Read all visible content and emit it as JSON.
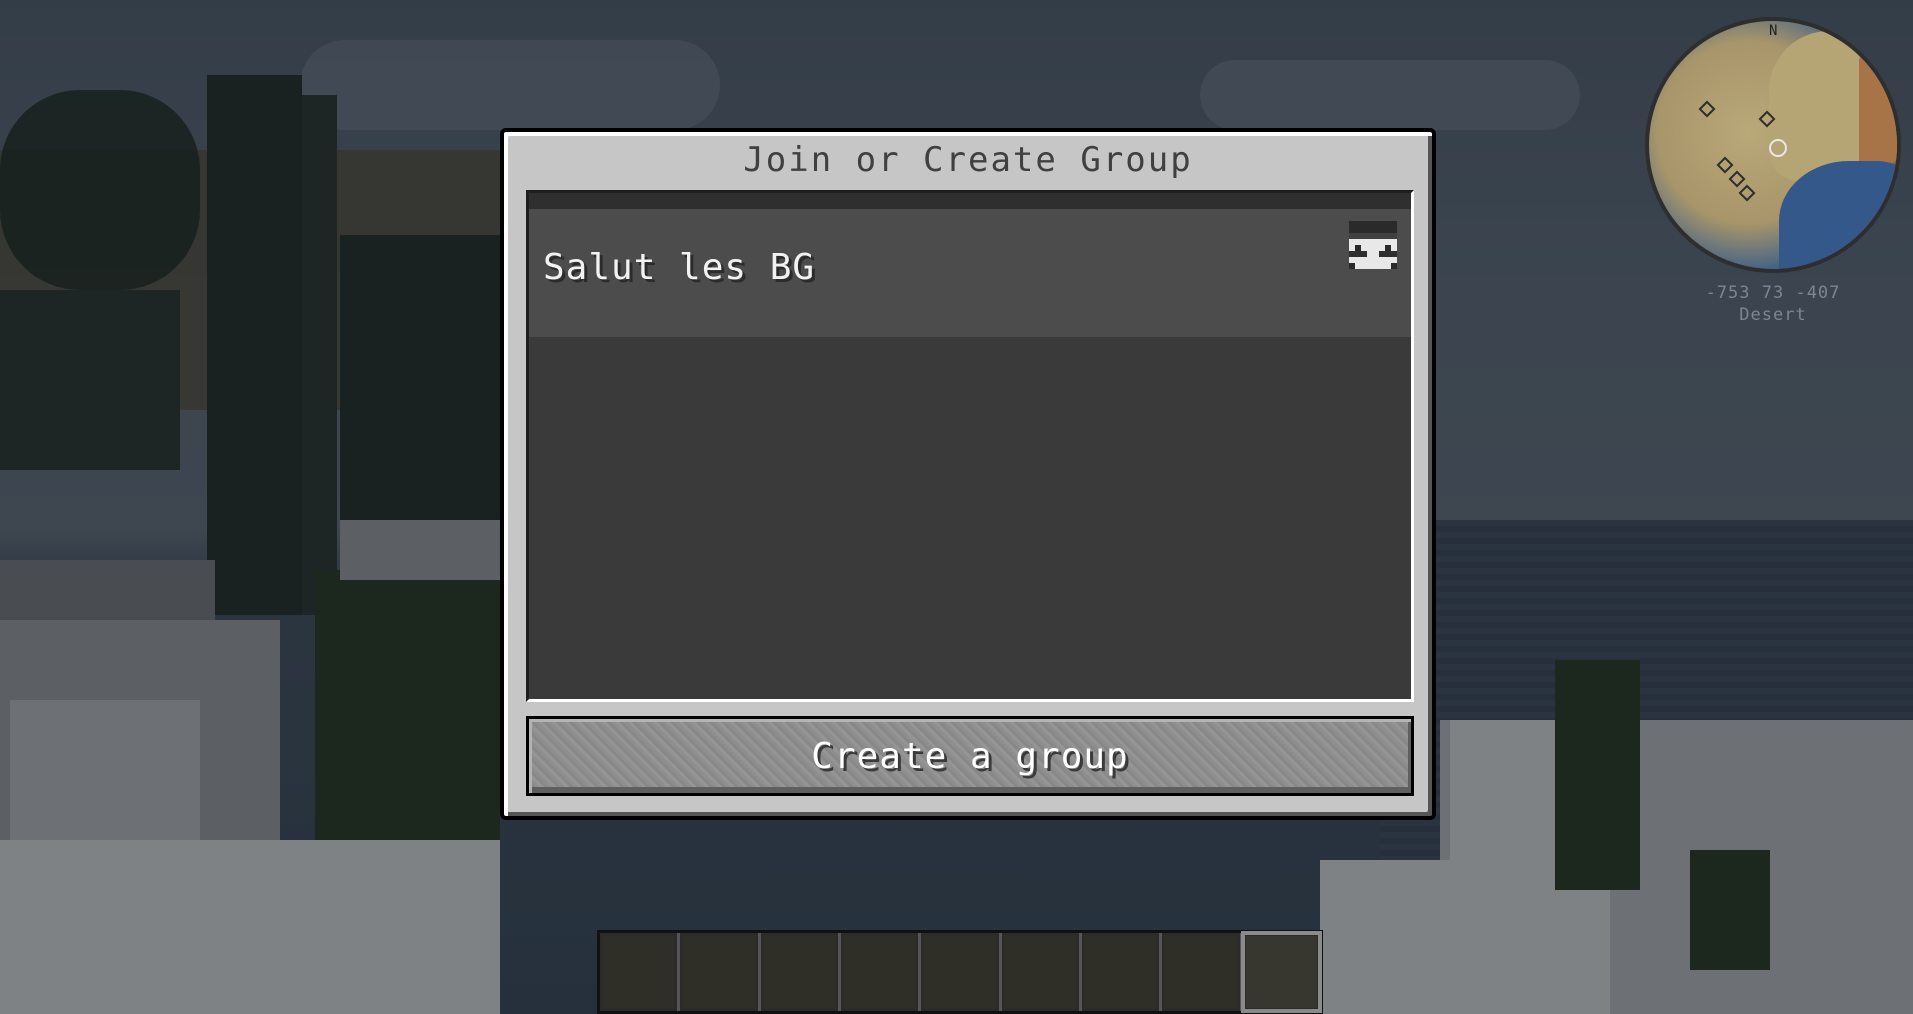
{
  "dialog": {
    "title": "Join or Create Group",
    "groups": [
      {
        "name": "Salut les BG",
        "owner_icon": "player-head-icon"
      }
    ],
    "create_button_label": "Create a group"
  },
  "minimap": {
    "north_label": "N",
    "coordinates": "-753 73 -407",
    "biome": "Desert"
  },
  "hotbar": {
    "slot_count": 9,
    "selected_slot": 8
  },
  "colors": {
    "dialog_bg": "#c6c6c6",
    "list_bg": "#3a3a3a",
    "entry_bg": "#4c4c4c",
    "button_bg": "#8e8e8e",
    "title_text": "#404040"
  }
}
